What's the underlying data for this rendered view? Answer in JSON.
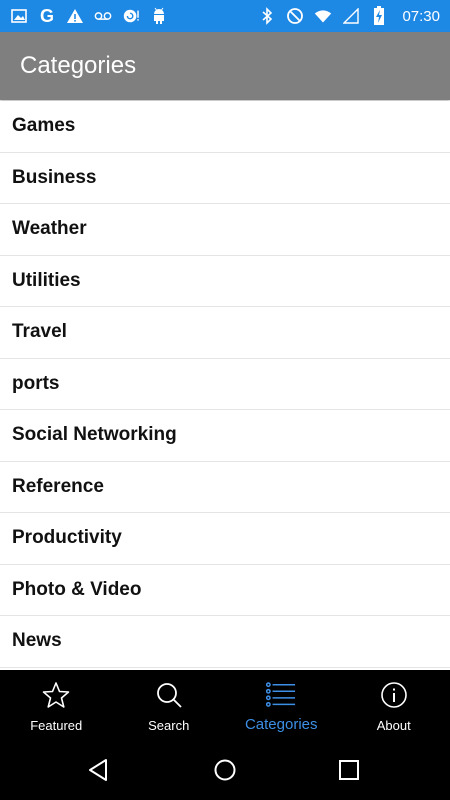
{
  "status_bar": {
    "left_icons": [
      "image-icon",
      "google-g-icon",
      "warning-icon",
      "voicemail-icon",
      "cloud-refresh-icon",
      "android-icon"
    ],
    "right_icons": [
      "bluetooth-icon",
      "do-not-disturb-icon",
      "wifi-icon",
      "signal-icon",
      "battery-charging-icon"
    ],
    "google_letter": "G",
    "time": "07:30"
  },
  "app_bar": {
    "title": "Categories"
  },
  "categories": [
    "Games",
    "Business",
    "Weather",
    "Utilities",
    "Travel",
    "ports",
    "Social Networking",
    "Reference",
    "Productivity",
    "Photo & Video",
    "News"
  ],
  "tabs": [
    {
      "label": "Featured",
      "icon": "star-icon",
      "active": false
    },
    {
      "label": "Search",
      "icon": "search-icon",
      "active": false
    },
    {
      "label": "Categories",
      "icon": "list-icon",
      "active": true
    },
    {
      "label": "About",
      "icon": "info-icon",
      "active": false
    }
  ],
  "colors": {
    "status_bar": "#1e88e5",
    "app_bar": "#7f7f7f",
    "tab_active": "#3d8fe6",
    "tab_bar": "#000000"
  }
}
